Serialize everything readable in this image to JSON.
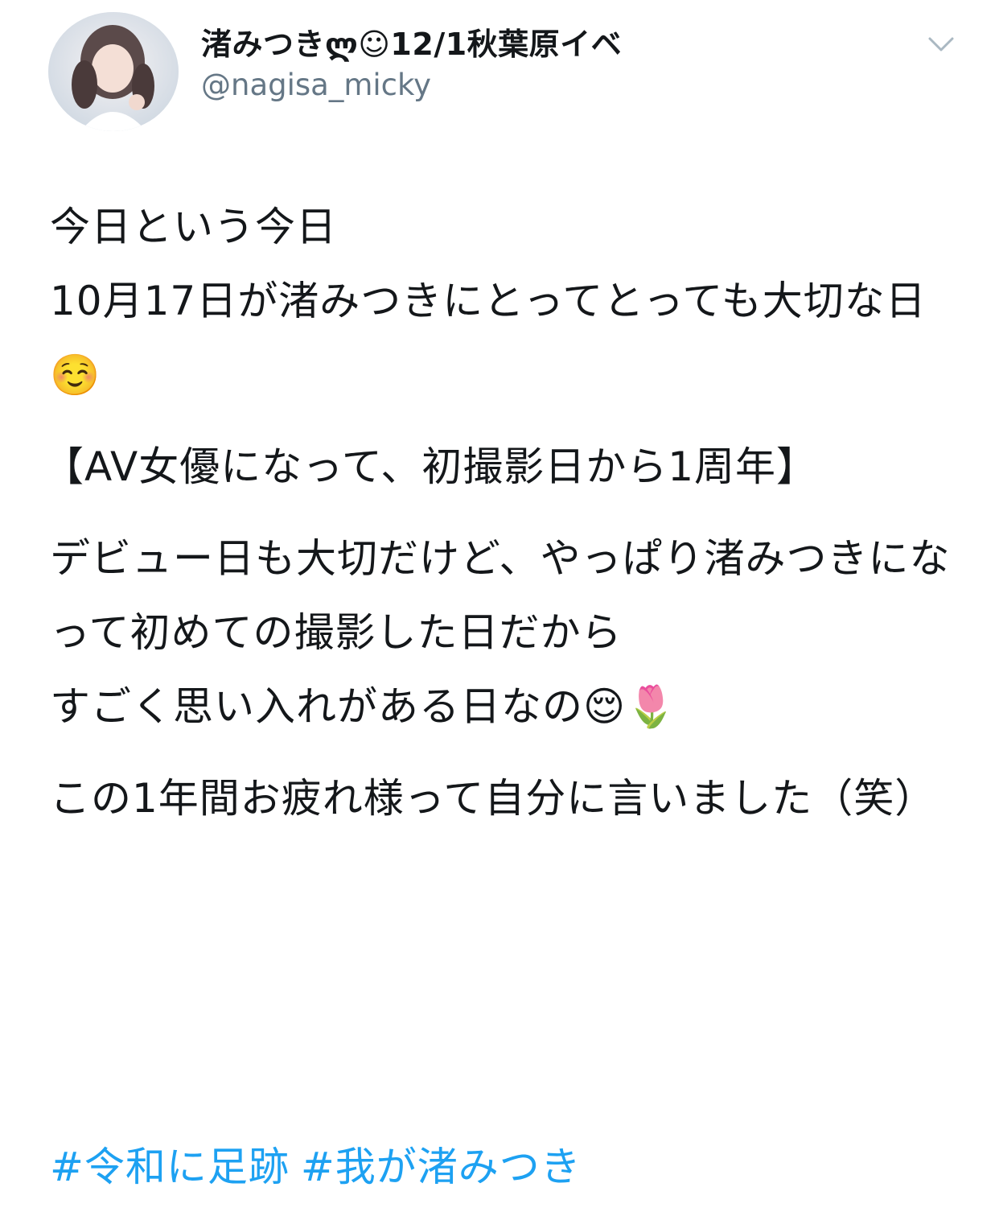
{
  "tweet": {
    "author": {
      "display_name": "渚みつきლ☺12/1秋葉原イベ",
      "handle": "@nagisa_micky"
    },
    "paragraphs": [
      "今日という今日\n10月17日が渚みつきにとってとっても大切な日☺️",
      "【AV女優になって、初撮影日から1周年】",
      "デビュー日も大切だけど、やっぱり渚みつきになって初めての撮影した日だから\nすごく思い入れがある日なの😌🌷",
      "この1年間お疲れ様って自分に言いました（笑）"
    ],
    "hashtags": [
      "#令和に足跡",
      "#我が渚みつき"
    ]
  },
  "icons": {
    "menu": "chevron-down-icon",
    "avatar": "profile-photo"
  },
  "colors": {
    "link": "#1da1f2",
    "secondary_text": "#657786",
    "primary_text": "#14171a"
  }
}
